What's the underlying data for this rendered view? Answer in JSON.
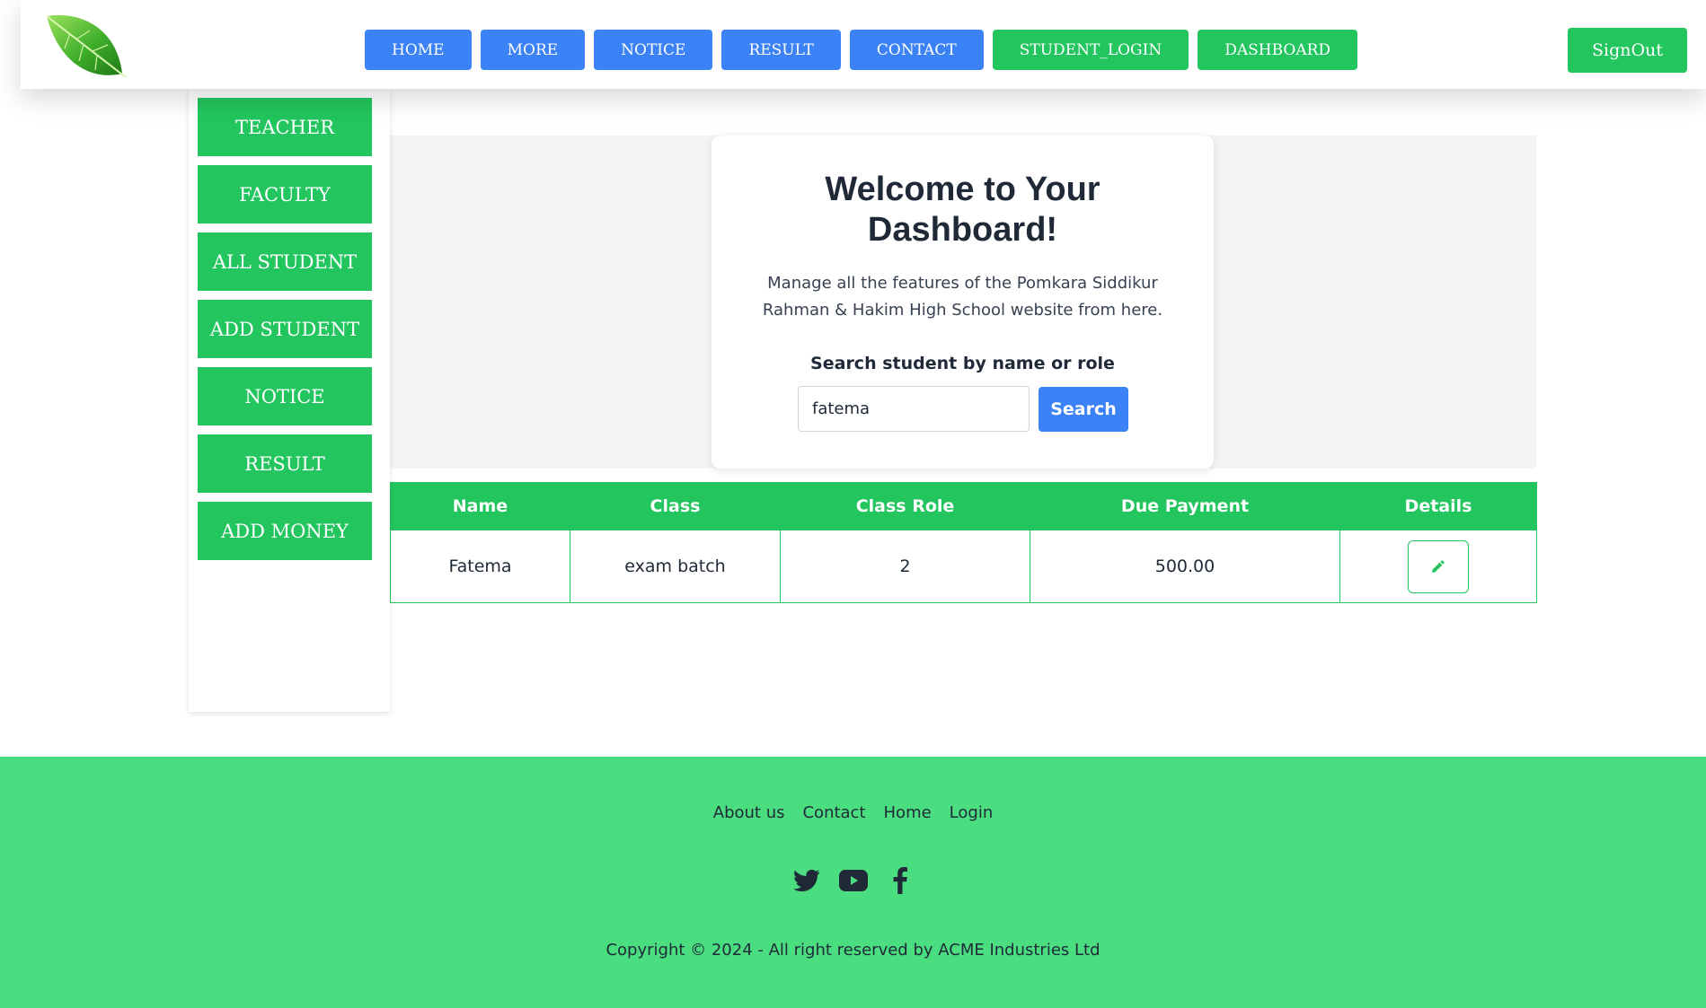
{
  "header": {
    "logo": "leaf-logo",
    "nav": [
      {
        "label": "HOME",
        "color": "#3b82f6"
      },
      {
        "label": "MORE",
        "color": "#3b82f6"
      },
      {
        "label": "NOTICE",
        "color": "#3b82f6"
      },
      {
        "label": "RESULT",
        "color": "#3b82f6"
      },
      {
        "label": "CONTACT",
        "color": "#3b82f6"
      },
      {
        "label": "STUDENT_LOGIN",
        "color": "#22c55e"
      },
      {
        "label": "DASHBOARD",
        "color": "#22c55e"
      }
    ],
    "signout_label": "SignOut"
  },
  "sidebar": {
    "items": [
      {
        "label": "TEACHER"
      },
      {
        "label": "FACULTY"
      },
      {
        "label": "ALL STUDENT"
      },
      {
        "label": "ADD STUDENT"
      },
      {
        "label": "NOTICE"
      },
      {
        "label": "RESULT"
      },
      {
        "label": "ADD MONEY"
      }
    ]
  },
  "hero": {
    "title": "Welcome to Your Dashboard!",
    "description": "Manage all the features of the Pomkara Siddikur Rahman & Hakim High School website from here.",
    "search_label": "Search student by name or role",
    "search_value": "fatema",
    "search_button": "Search"
  },
  "table": {
    "headers": [
      "Name",
      "Class",
      "Class Role",
      "Due Payment",
      "Details"
    ],
    "rows": [
      {
        "name": "Fatema",
        "class": "exam batch",
        "class_role": "2",
        "due_payment": "500.00",
        "details_icon": "pencil-icon"
      }
    ]
  },
  "footer": {
    "links": [
      "About us",
      "Contact",
      "Home",
      "Login"
    ],
    "social_icons": [
      "twitter-icon",
      "youtube-icon",
      "facebook-icon"
    ],
    "copyright": "Copyright © 2024 - All right reserved by ACME Industries Ltd"
  },
  "colors": {
    "primary_blue": "#3b82f6",
    "primary_green": "#22c55e",
    "footer_green": "#4ade80"
  }
}
